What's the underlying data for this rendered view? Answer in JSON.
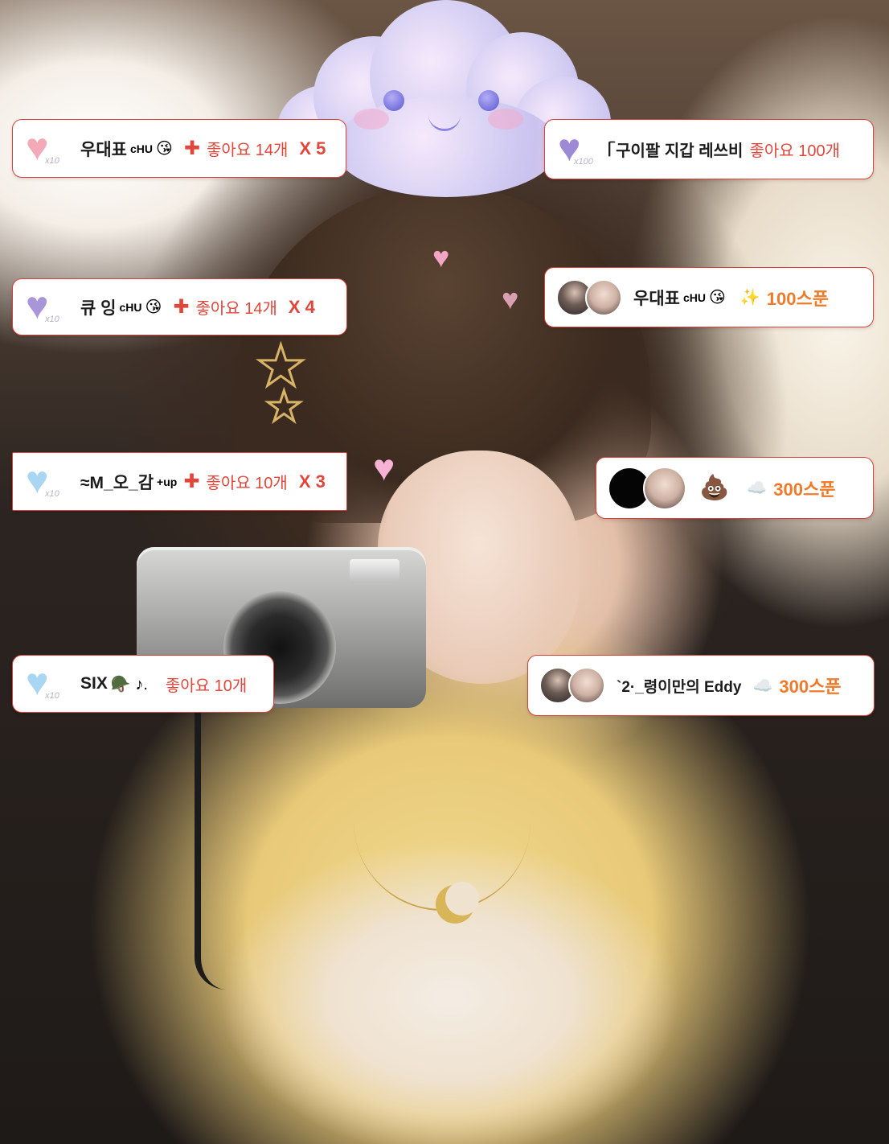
{
  "comments": [
    {
      "id": "c1",
      "name": "우대표",
      "sup": "cHU",
      "emoji": "😘",
      "badge_multiplier": "x10",
      "likes": "좋아요 14개",
      "count": "X 5"
    },
    {
      "id": "c2",
      "name": "큐 잉",
      "sup": "cHU",
      "emoji": "😘",
      "badge_multiplier": "x10",
      "likes": "좋아요 14개",
      "count": "X 4"
    },
    {
      "id": "c3",
      "name": "≈M_오_감",
      "sup": "+up",
      "badge_multiplier": "x10",
      "likes": "좋아요 10개",
      "count": "X 3"
    },
    {
      "id": "c4",
      "name": "SIX",
      "emoji": "🪖 ♪.",
      "badge_multiplier": "x10",
      "likes": "좋아요 10개"
    }
  ],
  "right_items": [
    {
      "id": "r1",
      "name": "ᥬ 구이팔 지갑 레쓰비",
      "badge_multiplier": "x100",
      "likes": "좋아요 100개"
    },
    {
      "id": "r2",
      "name": "우대표",
      "sup": "cHU",
      "emoji": "😘",
      "spoon_icon": "✨",
      "spoon": "100스푼"
    },
    {
      "id": "r3",
      "emoji": "💩",
      "spoon_icon": "☁️",
      "spoon": "300스푼"
    },
    {
      "id": "r4",
      "name": "`2·_령이만의 Eddy",
      "spoon_icon": "☁️",
      "spoon": "300스푼"
    }
  ],
  "icons": {
    "heart": "♥",
    "cross": "✚",
    "star": "★"
  },
  "colors": {
    "accent": "#e2463a",
    "spoon": "#f07a2a",
    "border": "#d9423a"
  }
}
